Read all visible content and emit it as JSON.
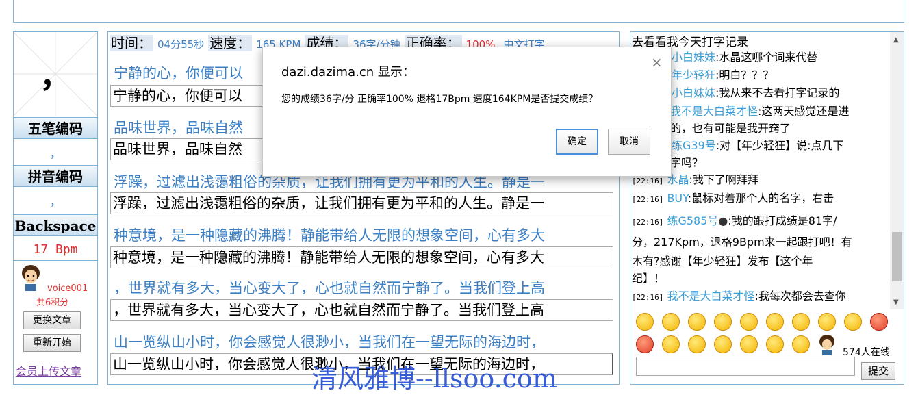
{
  "left": {
    "current_char": "，",
    "wubi_label": "五笔编码",
    "wubi_value": "，",
    "pinyin_label": "拼音编码",
    "pinyin_value": "，",
    "backspace_label": "Backspace",
    "backspace_bpm": "17 Bpm",
    "user_name": "voice001",
    "user_points": "共6积分",
    "change_article": "更换文章",
    "restart": "重新开始",
    "upload_article": "会员上传文章"
  },
  "stats": {
    "time_label": "时间：",
    "time_value": "04分55秒",
    "speed_label": "速度：",
    "kpm_value": "165 KPM",
    "score_label": "成绩：",
    "score_value": "36字/分钟",
    "accuracy_label": "正确率：",
    "accuracy_value": "100%",
    "mode": "中文打字"
  },
  "lines": [
    {
      "source": "宁静的心，你便可以",
      "typed": "宁静的心，你便可以"
    },
    {
      "source": "品味世界，品味自然",
      "typed": "品味世界，品味自然"
    },
    {
      "source": "浮躁，过滤出浅霭粗俗的杂质，让我们拥有更为平和的人生。静是一",
      "typed": "浮躁，过滤出浅霭粗俗的杂质，让我们拥有更为平和的人生。静是一"
    },
    {
      "source": "种意境，是一种隐藏的沸腾！静能带给人无限的想象空间，心有多大",
      "typed": "种意境，是一种隐藏的沸腾！静能带给人无限的想象空间，心有多大"
    },
    {
      "source": "，世界就有多大，当心变大了，心也就自然而宁静了。当我们登上高",
      "typed": "，世界就有多大，当心变大了，心也就自然而宁静了。当我们登上高"
    },
    {
      "source": "山一览纵山小时，你会感觉人很渺小，当我们在一望无际的海边时，",
      "typed": "山一览纵山小时，你会感觉人很渺小，当我们在一望无际的海边时，"
    }
  ],
  "dialog": {
    "title": "dazi.dazima.cn 显示：",
    "close": "×",
    "message": "您的成绩36字/分 正确率100% 退格17Bpm 速度164KPM是否提交成绩？",
    "ok": "确定",
    "cancel": "取消"
  },
  "chat": {
    "title": "去看看我今天打字记录",
    "messages": [
      {
        "nick": "小白妹妹",
        "text": ":水晶这哪个词来代替"
      },
      {
        "nick": "年少轻狂",
        "text": ":明白？？？"
      },
      {
        "nick": "小白妹妹",
        "text": ":我从来不去看打字记录的"
      },
      {
        "nick": "我不是大白菜才怪",
        "text": ":这两天感觉还是进"
      },
      {
        "text": "的，也有可能是我开窍了"
      },
      {
        "nick": "练G39号",
        "text": ":对【年少轻狂】说:点几下"
      },
      {
        "text": "字吗？"
      },
      {
        "ts": "[22:16]",
        "nick": "水晶",
        "text": ":我下了啊拜拜"
      },
      {
        "ts": "[22:16]",
        "nick": "BUY",
        "text": ":鼠标对着那个人的名字，右击"
      },
      {
        "ts": "[22:16]",
        "nick": "练G585号",
        "text": ":我的跟打成绩是81字/"
      },
      {
        "text": "分，217Kpm，退格9Bpm来一起跟打吧！有"
      },
      {
        "text": "木有?感谢【年少轻狂】发布【这个年"
      },
      {
        "text": "纪】！"
      },
      {
        "ts": "[22:16]",
        "nick": "我不是大白菜才怪",
        "text": ":我每次都会去查你"
      }
    ],
    "online": "574人在线",
    "submit": "提交",
    "emoji_icons": [
      "smile-icon",
      "grin-icon",
      "tongue-icon",
      "surprise-icon",
      "cool-icon",
      "blush-icon",
      "angry-icon",
      "wink-icon",
      "cry-icon",
      "mad-icon",
      "shy-icon",
      "neutral-icon",
      "laugh-icon",
      "happy-icon",
      "sad-icon",
      "sunglasses-icon",
      "sweat-icon"
    ]
  },
  "watermark": "清风雅博--llsoo.com"
}
